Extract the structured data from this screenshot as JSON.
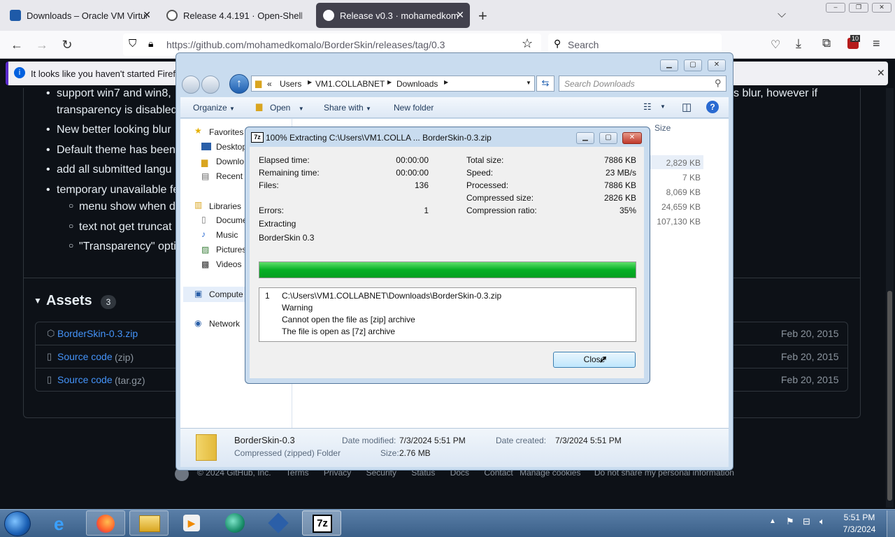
{
  "browser": {
    "tabs": [
      {
        "label": "Downloads – Oracle VM Virtuali",
        "active": false
      },
      {
        "label": "Release 4.4.191 · Open-Shell/Op",
        "active": false
      },
      {
        "label": "Release v0.3 · mohamedkomal",
        "active": true
      }
    ],
    "new_tab": "+",
    "url": "https://github.com/mohamedkomalo/BorderSkin/releases/tag/0.3",
    "search_placeholder": "Search",
    "extension_badge": "10",
    "info_message": "It looks like you haven't started Firefox i"
  },
  "github": {
    "bullets": [
      "support win7 and win8,",
      "transparency is disabled",
      "New better looking blur",
      "Default theme has been",
      "add all submitted langu",
      "temporary unavailable fe"
    ],
    "right_fragment": "s blur, however if",
    "sub_bullets": [
      "menu show when d",
      "text not get truncat",
      "\"Transparency\" opti"
    ],
    "assets_title": "Assets",
    "assets_count": "3",
    "assets": [
      {
        "name": "BorderSkin-0.3.zip",
        "date": "Feb 20, 2015"
      },
      {
        "name": "Source code",
        "suffix": "(zip)",
        "date": "Feb 20, 2015"
      },
      {
        "name": "Source code",
        "suffix": "(tar.gz)",
        "date": "Feb 20, 2015"
      }
    ],
    "footer": [
      "© 2024 GitHub, Inc.",
      "Terms",
      "Privacy",
      "Security",
      "Status",
      "Docs",
      "Contact",
      "Manage cookies",
      "Do not share my personal information"
    ]
  },
  "explorer": {
    "breadcrumb": [
      "«",
      "Users",
      "VM1.COLLABNET",
      "Downloads"
    ],
    "search_placeholder": "Search Downloads",
    "toolbar": {
      "organize": "Organize",
      "open": "Open",
      "share": "Share with",
      "new_folder": "New folder"
    },
    "nav": {
      "favorites": "Favorites",
      "fav_items": [
        "Desktop",
        "Downlo",
        "Recent"
      ],
      "libraries": "Libraries",
      "lib_items": [
        "Docume",
        "Music",
        "Pictures",
        "Videos"
      ],
      "computer": "Compute",
      "network": "Network"
    },
    "size_header": "Size",
    "sizes": [
      "2,829 KB",
      "7 KB",
      "8,069 KB",
      "24,659 KB",
      "107,130 KB"
    ],
    "details": {
      "name": "BorderSkin-0.3",
      "type": "Compressed (zipped) Folder",
      "modified_label": "Date modified:",
      "modified": "7/3/2024 5:51 PM",
      "size_label": "Size:",
      "size": "2.76 MB",
      "created_label": "Date created:",
      "created": "7/3/2024 5:51 PM"
    }
  },
  "dialog": {
    "title": "100% Extracting C:\\Users\\VM1.COLLA ... BorderSkin-0.3.zip",
    "left": [
      {
        "label": "Elapsed time:",
        "value": "00:00:00"
      },
      {
        "label": "Remaining time:",
        "value": "00:00:00"
      },
      {
        "label": "Files:",
        "value": "136"
      },
      {
        "label": "Errors:",
        "value": "1"
      }
    ],
    "right": [
      {
        "label": "Total size:",
        "value": "7886 KB"
      },
      {
        "label": "Speed:",
        "value": "23 MB/s"
      },
      {
        "label": "Processed:",
        "value": "7886 KB"
      },
      {
        "label": "Compressed size:",
        "value": "2826 KB"
      },
      {
        "label": "Compression ratio:",
        "value": "35%"
      }
    ],
    "status": "Extracting",
    "current": "BorderSkin 0.3",
    "progress": 1.0,
    "log_index": "1",
    "log": [
      "C:\\Users\\VM1.COLLABNET\\Downloads\\BorderSkin-0.3.zip",
      "Warning",
      "Cannot open the file as [zip] archive",
      "The file is open as [7z] archive"
    ],
    "close_label": "Close"
  },
  "taskbar": {
    "time": "5:51 PM",
    "date": "7/3/2024",
    "app_7z": "7z"
  },
  "colors": {
    "accent": "#4493f8",
    "progress": "#06b025",
    "github_bg": "#0d1117"
  }
}
